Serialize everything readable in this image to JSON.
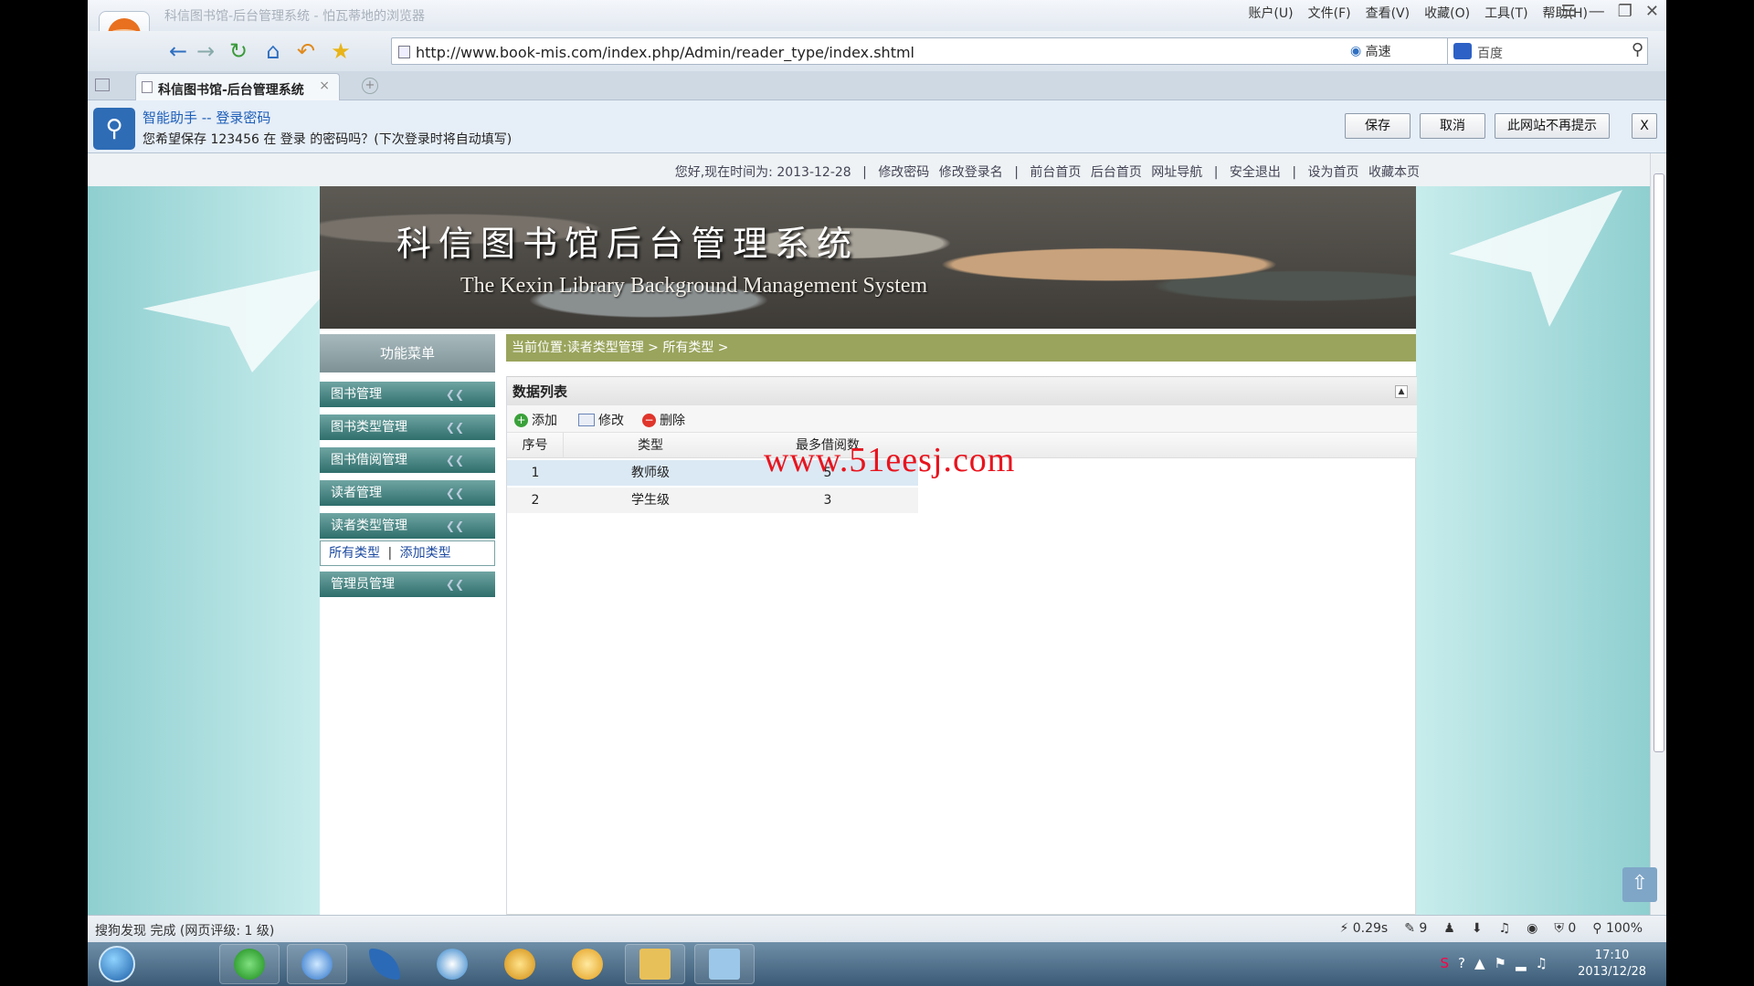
{
  "browser": {
    "title": "科信图书馆-后台管理系统 - 怕瓦蒂地的浏览器",
    "menu": [
      "账户(U)",
      "文件(F)",
      "查看(V)",
      "收藏(O)",
      "工具(T)",
      "帮助(H)"
    ],
    "url": "http://www.book-mis.com/index.php/Admin/reader_type/index.shtml",
    "speed_label": "高速",
    "search_placeholder": "百度",
    "tab_title": "科信图书馆-后台管理系统",
    "tab_close": "×",
    "newtab": "+"
  },
  "password_bar": {
    "title": "智能助手 -- 登录密码",
    "message": "您希望保存 123456 在 登录 的密码吗？(下次登录时将自动填写)",
    "save": "保存",
    "cancel": "取消",
    "never": "此网站不再提示",
    "close": "X"
  },
  "topbar": {
    "greeting": "您好,现在时间为: 2013-12-28",
    "sep": "|",
    "links": [
      "修改密码",
      "修改登录名",
      "前台首页",
      "后台首页",
      "网址导航",
      "安全退出",
      "设为首页",
      "收藏本页"
    ]
  },
  "banner": {
    "title_cn": "科信图书馆后台管理系统",
    "title_en": "The Kexin Library Background Management System"
  },
  "sidebar": {
    "header": "功能菜单",
    "items": [
      "图书管理",
      "图书类型管理",
      "图书借阅管理",
      "读者管理",
      "读者类型管理",
      "管理员管理"
    ],
    "sub_links": [
      "所有类型",
      "添加类型"
    ],
    "sub_sep": "|"
  },
  "breadcrumb": "当前位置:读者类型管理 > 所有类型 >",
  "panel": {
    "title": "数据列表",
    "toolbar": [
      "添加",
      "修改",
      "删除"
    ],
    "columns": [
      "序号",
      "类型",
      "最多借阅数"
    ],
    "rows": [
      {
        "no": "1",
        "type": "教师级",
        "max": "5"
      },
      {
        "no": "2",
        "type": "学生级",
        "max": "3"
      }
    ]
  },
  "watermark": "www.51eesj.com",
  "statusbar": {
    "left": "搜狗发现  完成 (网页评级: 1 级)",
    "time": "0.29s",
    "count1": "9",
    "count2": "0",
    "zoom": "100%"
  },
  "taskbar": {
    "time": "17:10",
    "date": "2013/12/28"
  }
}
